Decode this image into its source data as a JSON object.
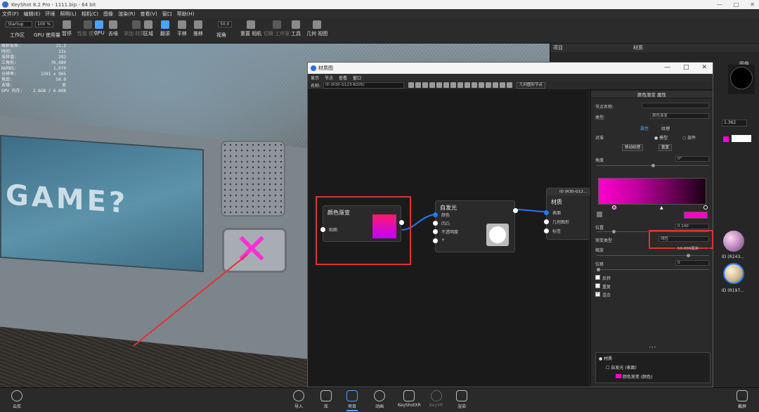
{
  "window": {
    "title": "KeyShot 8.2 Pro - 1111.bip - 64 bit",
    "controls": [
      "—",
      "□",
      "✕"
    ]
  },
  "menu": [
    "文件(F)",
    "编辑(E)",
    "环境",
    "照明(L)",
    "相机(C)",
    "图像",
    "渲染(R)",
    "查看(V)",
    "窗口",
    "帮助(H)"
  ],
  "toolbar": {
    "workspace_box": "Startup",
    "zoom_box": "100 %",
    "fov_box": "50.0",
    "items": [
      {
        "label": "工作区",
        "dim": false
      },
      {
        "label": "GPU 使用量",
        "dim": false
      },
      {
        "label": "暂停",
        "dim": false
      },
      {
        "label": "性能 模式",
        "dim": true
      },
      {
        "label": "GPU",
        "dim": false
      },
      {
        "label": "去噪",
        "dim": false
      },
      {
        "label": "添加 材质...",
        "dim": true
      },
      {
        "label": "区域",
        "dim": false
      },
      {
        "label": "翻滚",
        "dim": false
      },
      {
        "label": "平移",
        "dim": false
      },
      {
        "label": "推移",
        "dim": false
      },
      {
        "label": "视角",
        "dim": false
      },
      {
        "label": "重置 相机",
        "dim": false
      },
      {
        "label": "切换 工作室",
        "dim": true
      },
      {
        "label": "工具",
        "dim": false
      },
      {
        "label": "几何 视图",
        "dim": false
      }
    ]
  },
  "stats": [
    {
      "k": "每秒采样:",
      "v": "21.2"
    },
    {
      "k": "时间:",
      "v": "13s"
    },
    {
      "k": "采样值:",
      "v": "292"
    },
    {
      "k": "三角形:",
      "v": "70,080"
    },
    {
      "k": "NURBS:",
      "v": "1,079"
    },
    {
      "k": "分辨率:",
      "v": "1391 x 965"
    },
    {
      "k": "焦距:",
      "v": "50.0"
    },
    {
      "k": "去噪:",
      "v": "关"
    },
    {
      "k": "GPU 内存:",
      "v": "2.6GB / 6.0GB"
    }
  ],
  "viewport": {
    "game_text": "GAME?"
  },
  "right_panel": {
    "tab_project": "项目",
    "tab_material": "材质",
    "image_label": "图像",
    "value": "1.362",
    "thumb_labels": [
      "ID (R243...",
      "ID (R197..."
    ]
  },
  "material_window": {
    "title": "材质图",
    "controls": [
      "—",
      "□",
      "✕"
    ],
    "menu": [
      "显示",
      "节点",
      "查看",
      "窗口"
    ],
    "name_label": "名称:",
    "name_value": "ID (R30-G123-B205)",
    "geo_button": "几何图形节点"
  },
  "graph": {
    "node_gradient": {
      "title": "颜色渐变",
      "port": "贴图"
    },
    "node_emissive": {
      "title": "自发光",
      "ports": [
        "颜色",
        "凹凸",
        "不透明度",
        "+"
      ]
    },
    "node_material": {
      "title": "材质",
      "header": "ID (R30-G12...",
      "ports": [
        "表面",
        "几何图形",
        "标签"
      ]
    }
  },
  "properties": {
    "header": "颜色渐变 属性",
    "node_name_label": "节点名称:",
    "type_label": "类型:",
    "type_value": "颜色渐变",
    "tab_props": "属性",
    "tab_texture": "纹理",
    "mapping_label": "对准",
    "radio_model": "模型",
    "radio_part": "部件",
    "btn_move": "移动纹理",
    "btn_reset": "重置",
    "angle_label": "角度",
    "angle_value": "0°",
    "position_label": "位置",
    "position_value": "0.140",
    "gradient_type_label": "渐变类型",
    "gradient_type_value": "线性",
    "scale_label": "缩放",
    "scale_value": "10.000毫米",
    "offset_label": "位移",
    "offset_value": "0",
    "cb_invert": "反转",
    "cb_repeat": "重复",
    "cb_blend": "混合",
    "tree": [
      "材质",
      "自发光 (表面)",
      "颜色渐变 (颜色)"
    ]
  },
  "bottom": [
    {
      "label": "云库",
      "dim": false
    },
    {
      "label": "导入",
      "dim": false
    },
    {
      "label": "库",
      "dim": false
    },
    {
      "label": "项目",
      "dim": false
    },
    {
      "label": "动画",
      "dim": false
    },
    {
      "label": "KeyShotXR",
      "dim": false
    },
    {
      "label": "KeyVR",
      "dim": true
    },
    {
      "label": "渲染",
      "dim": false
    },
    {
      "label": "截屏",
      "dim": false
    }
  ],
  "colors": {
    "accent": "#4aa3ff",
    "highlight_red": "#e03232",
    "gradient_start": "#ff00cc",
    "connection": "#1f78ff"
  }
}
